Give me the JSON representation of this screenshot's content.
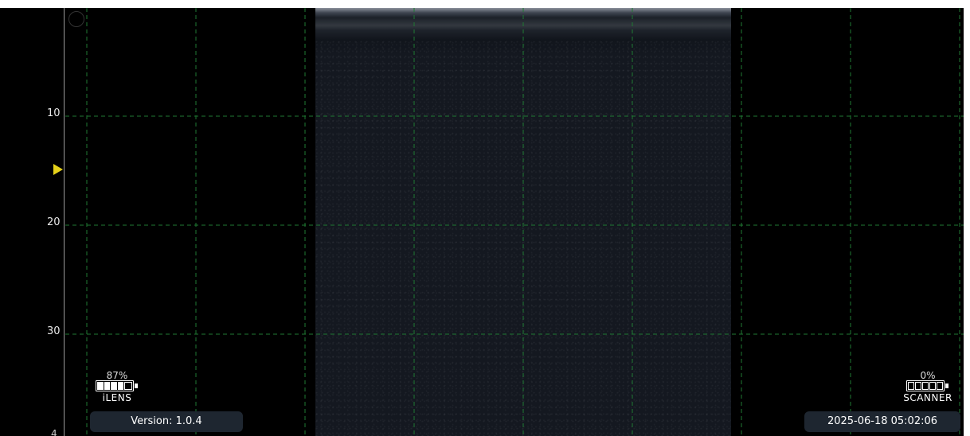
{
  "depth_ruler": {
    "tick_labels": [
      "10",
      "20",
      "30",
      "4"
    ],
    "marker_icon": "triangle-right-icon",
    "marker_color": "#e6d21a"
  },
  "grid": {
    "color": "#1f7a33",
    "style": "dashed"
  },
  "ilens_battery": {
    "percent_label": "87%",
    "name": "iLENS",
    "level": 0.87,
    "icon": "battery-icon"
  },
  "scanner_battery": {
    "percent_label": "0%",
    "name": "SCANNER",
    "level": 0.0,
    "icon": "battery-icon"
  },
  "version_label": "Version: 1.0.4",
  "timestamp": "2025-06-18 05:02:06"
}
